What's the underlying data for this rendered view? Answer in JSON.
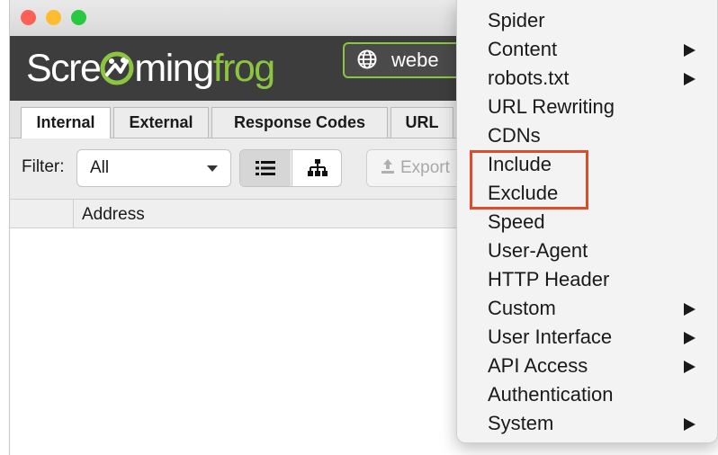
{
  "app": {
    "logo_prefix": "Scre",
    "logo_middle": "ming",
    "logo_suffix": "frog",
    "url_value": "webe"
  },
  "tabs": [
    {
      "label": "Internal"
    },
    {
      "label": "External"
    },
    {
      "label": "Response Codes"
    },
    {
      "label": "URL"
    }
  ],
  "toolbar": {
    "filter_label": "Filter:",
    "filter_value": "All",
    "export_label": "Export"
  },
  "grid": {
    "address_header": "Address"
  },
  "menu": {
    "items": [
      {
        "label": "Spider"
      },
      {
        "label": "Content",
        "submenu": true
      },
      {
        "label": "robots.txt",
        "submenu": true
      },
      {
        "label": "URL Rewriting"
      },
      {
        "label": "CDNs"
      },
      {
        "label": "Include"
      },
      {
        "label": "Exclude"
      },
      {
        "label": "Speed"
      },
      {
        "label": "User-Agent"
      },
      {
        "label": "HTTP Header"
      },
      {
        "label": "Custom",
        "submenu": true
      },
      {
        "label": "User Interface",
        "submenu": true
      },
      {
        "label": "API Access",
        "submenu": true
      },
      {
        "label": "Authentication"
      },
      {
        "label": "System",
        "submenu": true
      }
    ]
  },
  "colors": {
    "brand_green": "#8cc53f",
    "highlight_red": "#e04b2d",
    "traffic_close": "#fe5f57",
    "traffic_min": "#febc2e",
    "traffic_max": "#28c840"
  }
}
